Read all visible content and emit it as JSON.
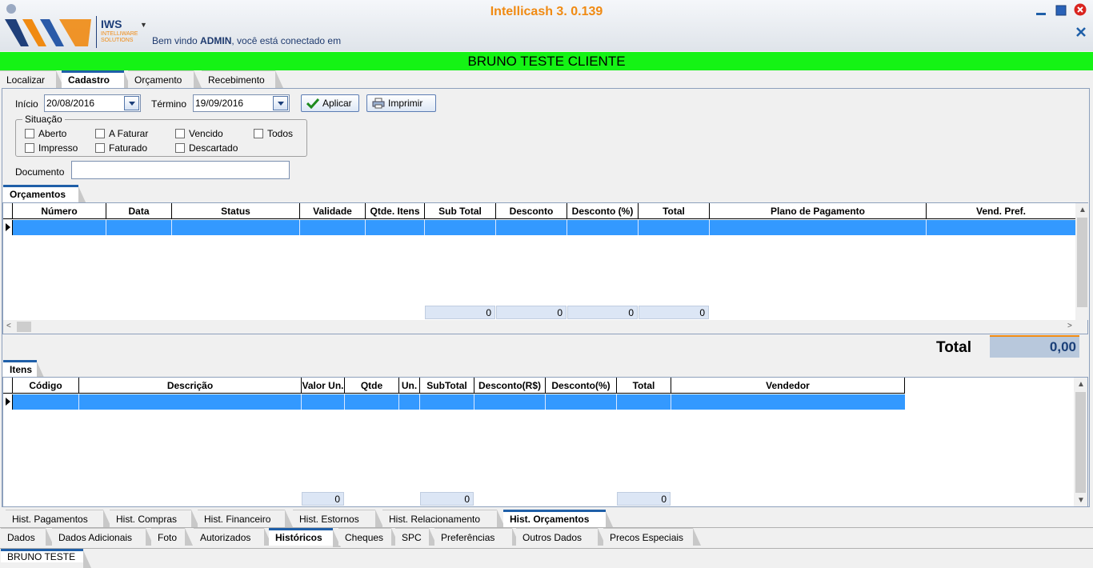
{
  "app": {
    "title": "Intellicash 3. 0.139",
    "welcome_prefix": "Bem vindo ",
    "welcome_user": "ADMIN",
    "welcome_suffix": ", você está conectado em",
    "logo_text": "IWS",
    "logo_sub1": "INTELLIWARE",
    "logo_sub2": "SOLUTIONS",
    "accent": "#f08a12",
    "banner_color": "#15f315"
  },
  "banner": {
    "customer": "BRUNO TESTE CLIENTE"
  },
  "top_tabs": [
    {
      "label": "Localizar",
      "active": false
    },
    {
      "label": "Cadastro",
      "active": true
    },
    {
      "label": "Orçamento",
      "active": false
    },
    {
      "label": "Recebimento",
      "active": false
    }
  ],
  "filters": {
    "start_label": "Início",
    "start_value": "20/08/2016",
    "end_label": "Término",
    "end_value": "19/09/2016",
    "apply_label": "Aplicar",
    "print_label": "Imprimir",
    "situation_label": "Situação",
    "checkboxes": [
      "Aberto",
      "A Faturar",
      "Vencido",
      "Todos",
      "Impresso",
      "Faturado",
      "Descartado"
    ],
    "document_label": "Documento",
    "document_value": ""
  },
  "quotes": {
    "section_label": "Orçamentos",
    "columns": [
      "Número",
      "Data",
      "Status",
      "Validade",
      "Qtde. Itens",
      "Sub Total",
      "Desconto",
      "Desconto (%)",
      "Total",
      "Plano de Pagamento",
      "Vend. Pref."
    ],
    "footer": [
      "0",
      "0",
      "0",
      "0"
    ]
  },
  "total": {
    "label": "Total",
    "value": "0,00"
  },
  "items": {
    "section_label": "Itens",
    "columns": [
      "Código",
      "Descrição",
      "Valor Un.",
      "Qtde",
      "Un.",
      "SubTotal",
      "Desconto(R$)",
      "Desconto(%)",
      "Total",
      "Vendedor"
    ],
    "footer": [
      "0",
      "0",
      "0"
    ]
  },
  "hist_tabs": [
    {
      "label": "Hist. Pagamentos",
      "active": false
    },
    {
      "label": "Hist. Compras",
      "active": false
    },
    {
      "label": "Hist. Financeiro",
      "active": false
    },
    {
      "label": "Hist. Estornos",
      "active": false
    },
    {
      "label": "Hist. Relacionamento",
      "active": false
    },
    {
      "label": "Hist. Orçamentos",
      "active": true
    }
  ],
  "data_tabs": [
    {
      "label": "Dados",
      "active": false
    },
    {
      "label": "Dados Adicionais",
      "active": false
    },
    {
      "label": "Foto",
      "active": false
    },
    {
      "label": "Autorizados",
      "active": false
    },
    {
      "label": "Históricos",
      "active": true
    },
    {
      "label": "Cheques",
      "active": false
    },
    {
      "label": "SPC",
      "active": false
    },
    {
      "label": "Preferências",
      "active": false
    },
    {
      "label": "Outros Dados",
      "active": false
    },
    {
      "label": "Precos Especiais",
      "active": false
    }
  ],
  "status_tabs": [
    {
      "label": "BRUNO TESTE",
      "active": true
    }
  ]
}
